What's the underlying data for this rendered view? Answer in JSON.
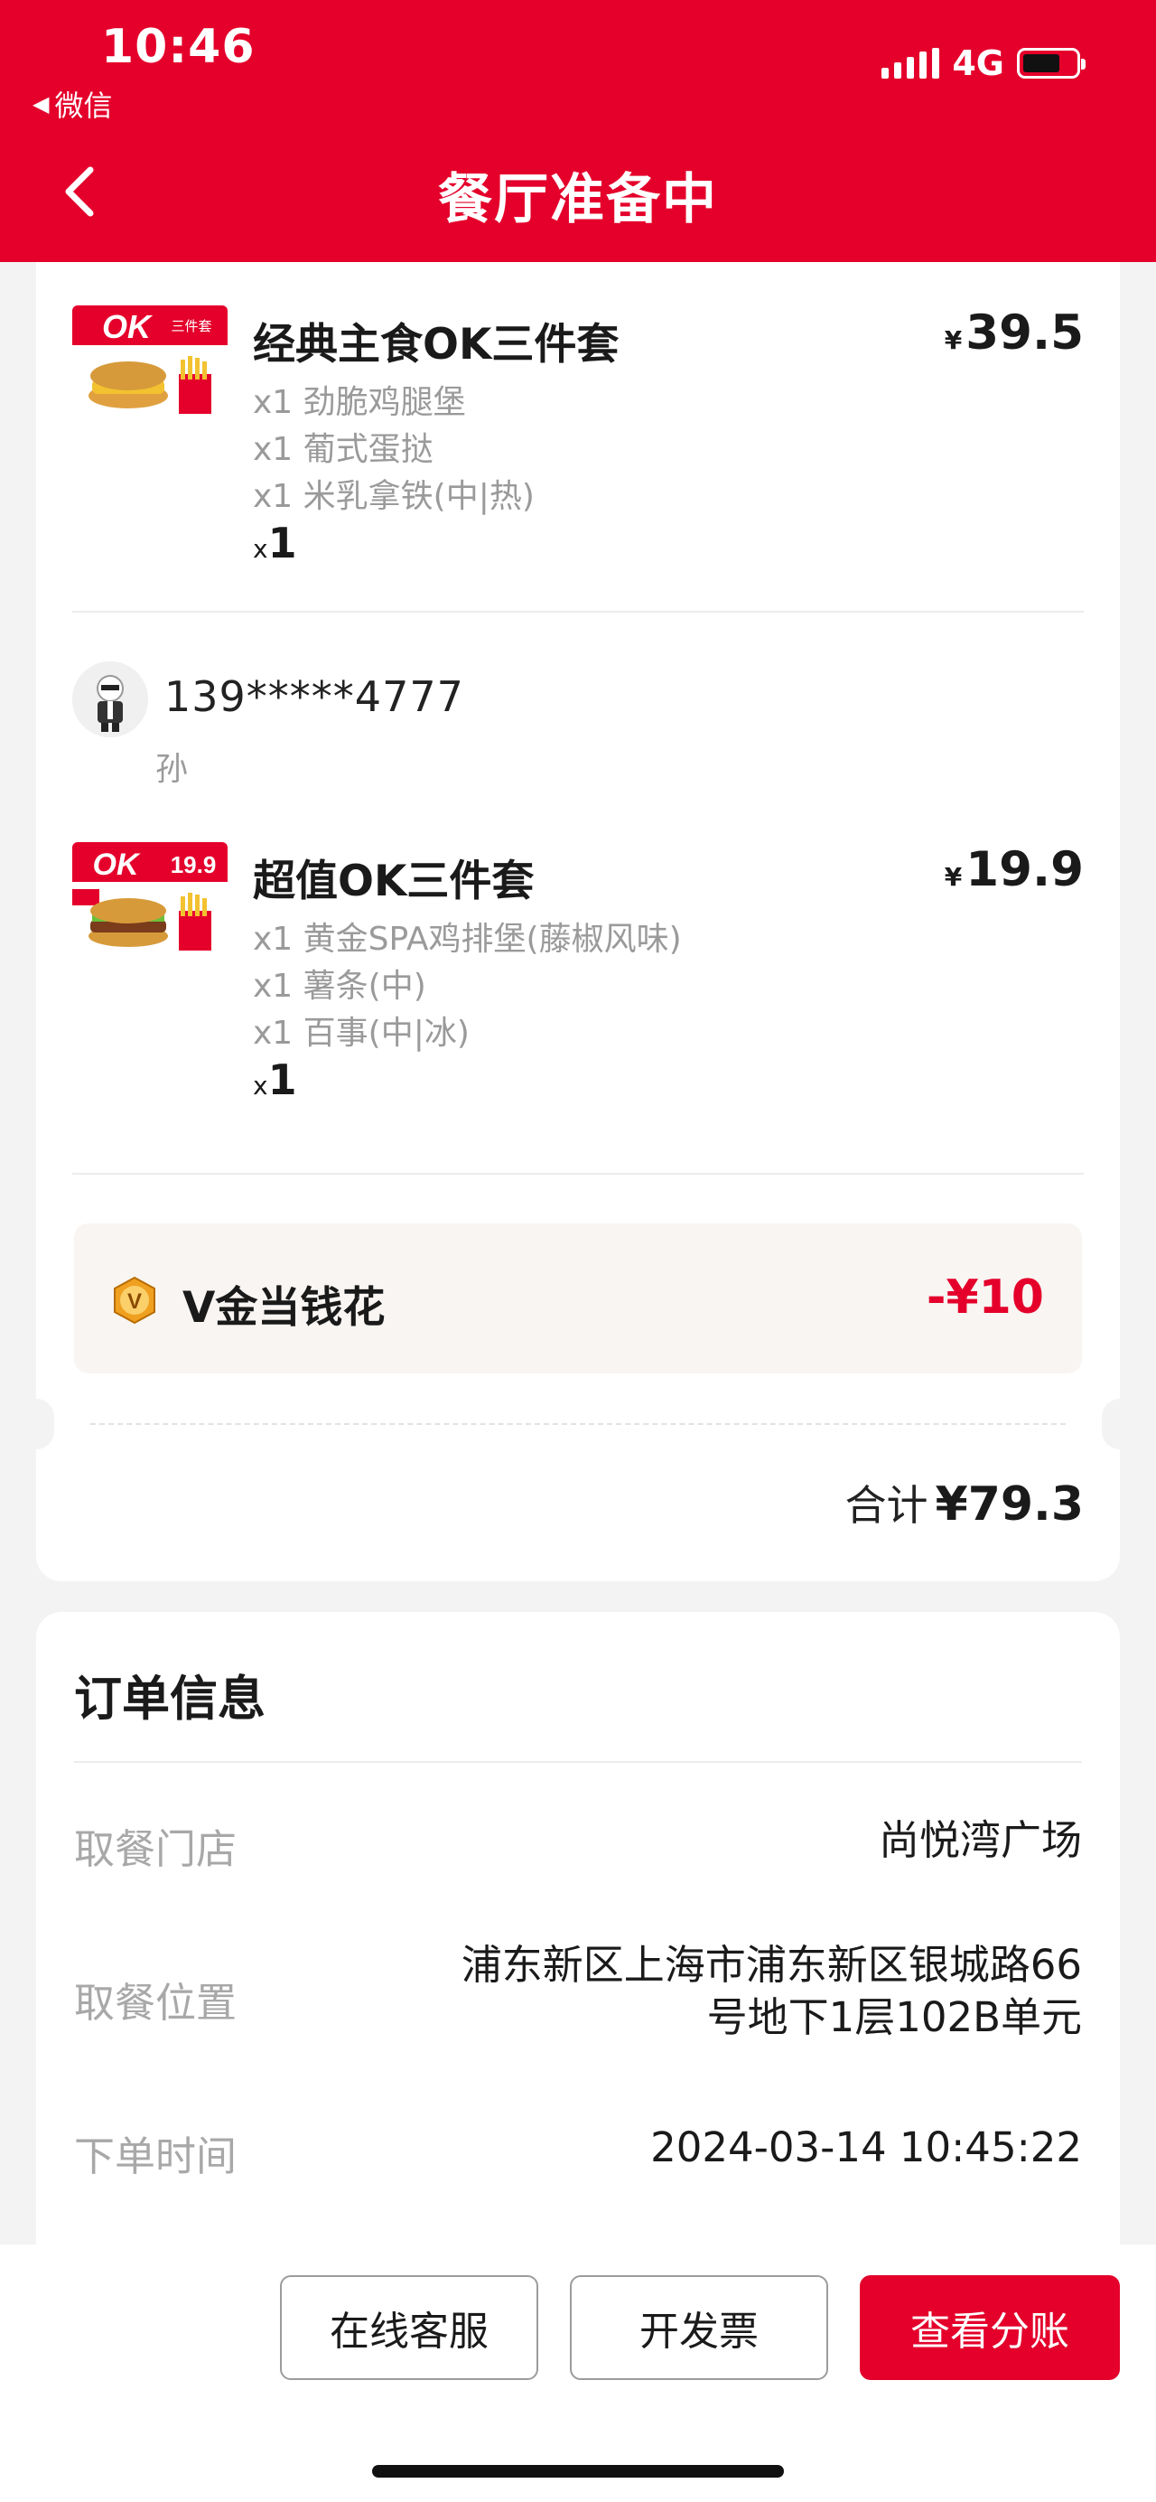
{
  "status_bar": {
    "time": "10:46",
    "back_app": "微信",
    "network": "4G"
  },
  "nav": {
    "title": "餐厅准备中"
  },
  "order_items": [
    {
      "thumb_text": "OK",
      "thumb_badge": "三件套",
      "name": "经典主食OK三件套",
      "price_symbol": "¥",
      "price": "39.5",
      "components": [
        "x1 劲脆鸡腿堡",
        "x1 葡式蛋挞",
        "x1 米乳拿铁(中|热)"
      ],
      "qty_prefix": "x",
      "qty": "1"
    },
    {
      "thumb_text": "OK",
      "thumb_badge": "19.9",
      "name": "超值OK三件套",
      "price_symbol": "¥",
      "price": "19.9",
      "components": [
        "x1 黄金SPA鸡排堡(藤椒风味)",
        "x1 薯条(中)",
        "x1 百事(中|冰)"
      ],
      "qty_prefix": "x",
      "qty": "1"
    }
  ],
  "shared_user": {
    "phone": "139*****4777",
    "name": "孙"
  },
  "discount": {
    "label": "V金当钱花",
    "amount": "-¥10"
  },
  "total": {
    "label": "合计",
    "amount": "¥79.3"
  },
  "order_info": {
    "title": "订单信息",
    "rows": [
      {
        "label": "取餐门店",
        "value": "尚悦湾广场"
      },
      {
        "label": "取餐位置",
        "value_line1": "浦东新区上海市浦东新区银城路66",
        "value_line2": "号地下1层102B单元"
      },
      {
        "label": "下单时间",
        "value": "2024-03-14 10:45:22"
      }
    ]
  },
  "actions": {
    "service": "在线客服",
    "invoice": "开发票",
    "split": "查看分账"
  },
  "colors": {
    "brand_red": "#e4002b",
    "muted_text": "#9a9a9a",
    "discount_bg": "#f8f5f2"
  },
  "icons": [
    "back-arrow-icon",
    "signal-icon",
    "battery-icon",
    "v-coin-icon",
    "user-avatar-icon"
  ]
}
